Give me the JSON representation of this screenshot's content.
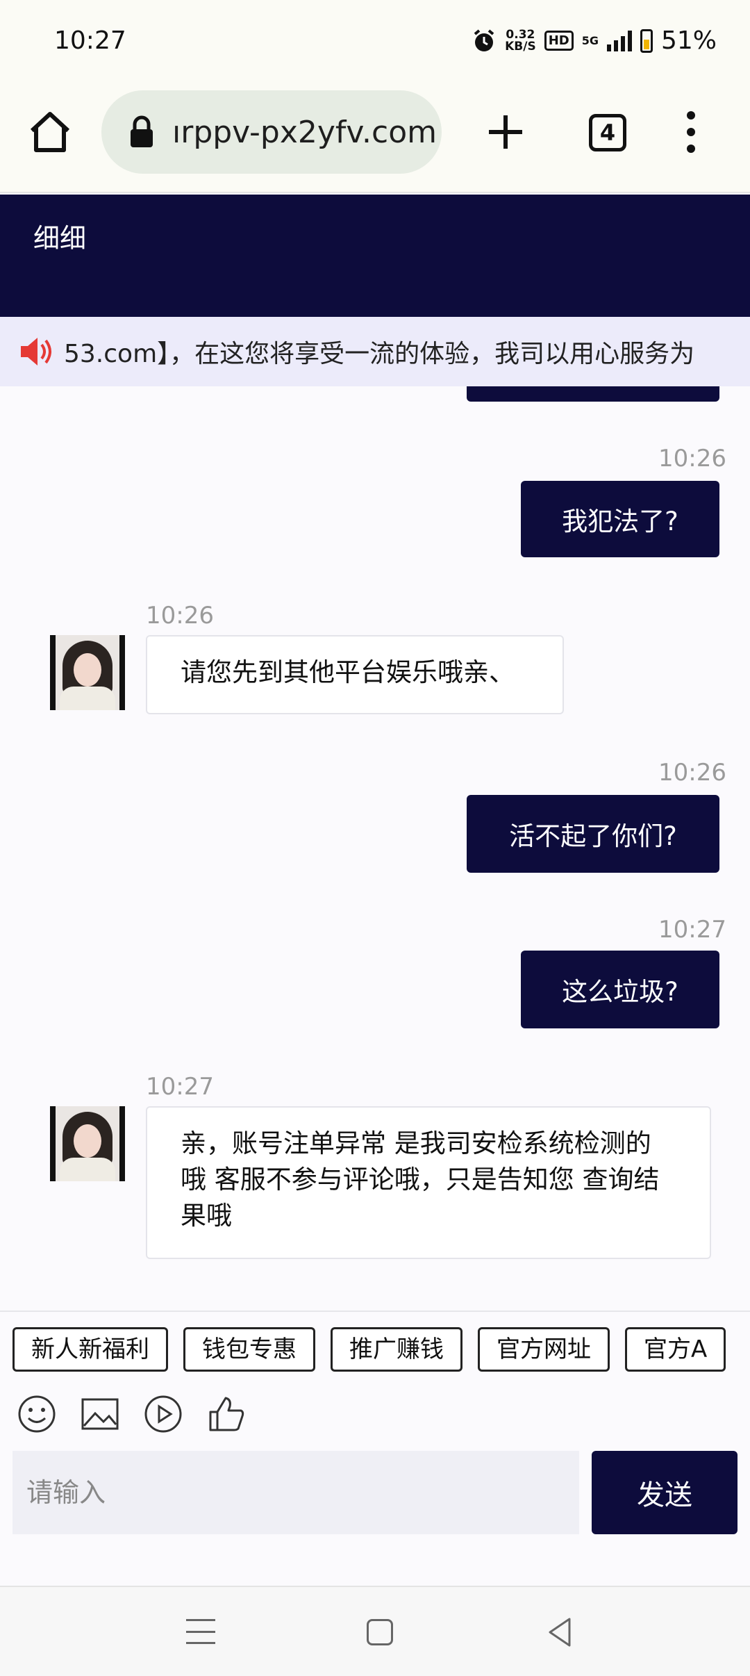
{
  "status_bar": {
    "time": "10:27",
    "net_speed_value": "0.32",
    "net_speed_unit": "KB/S",
    "hd": "HD",
    "signal": "5G",
    "battery": "51%"
  },
  "browser": {
    "url": "ırppv-px2yfv.com",
    "tab_count": "4"
  },
  "chat": {
    "title": "细细",
    "notice": "53.com】，在这您将享受一流的体验，我司以用心服务为",
    "messages": [
      {
        "time": "10:26",
        "text": "我犯法了?",
        "from": "me"
      },
      {
        "time": "10:26",
        "text": "请您先到其他平台娱乐哦亲、",
        "from": "agent"
      },
      {
        "time": "10:26",
        "text": "活不起了你们?",
        "from": "me"
      },
      {
        "time": "10:27",
        "text": "这么垃圾?",
        "from": "me"
      },
      {
        "time": "10:27",
        "text": "亲，账号注单异常 是我司安检系统检测的哦 客服不参与评论哦，只是告知您 查询结果哦",
        "from": "agent"
      }
    ]
  },
  "quick_tags": [
    "新人新福利",
    "钱包专惠",
    "推广赚钱",
    "官方网址",
    "官方A"
  ],
  "input": {
    "placeholder": "请输入",
    "send_label": "发送"
  },
  "colors": {
    "accent": "#0d0c3c",
    "notice_bg": "#ecebfa",
    "url_bg": "#e6ece3"
  }
}
